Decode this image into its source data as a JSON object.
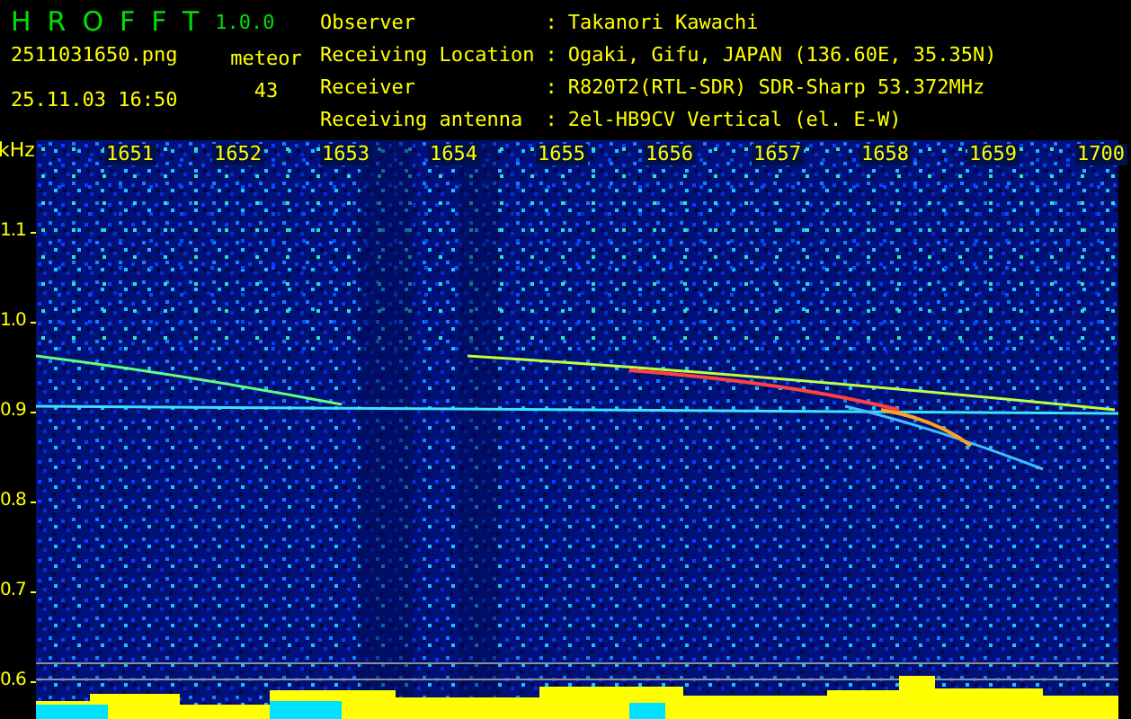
{
  "header": {
    "app_name": "HROFFT",
    "version": "1.0.0",
    "filename": "2511031650.png",
    "datetime": "25.11.03 16:50",
    "meteor_label": "meteor",
    "meteor_count": "43"
  },
  "station_info": [
    {
      "label": "Observer",
      "separator": ":",
      "value": "Takanori Kawachi"
    },
    {
      "label": "Receiving Location",
      "separator": ":",
      "value": "Ogaki, Gifu, JAPAN (136.60E, 35.35N)"
    },
    {
      "label": "Receiver",
      "separator": ":",
      "value": "R820T2(RTL-SDR) SDR-Sharp 53.372MHz"
    },
    {
      "label": "Receiving antenna",
      "separator": ":",
      "value": "2el-HB9CV Vertical (el. E-W)"
    }
  ],
  "spectrogram": {
    "unit": "kHz",
    "frequency_labels": [
      "1.1",
      "1.0",
      "0.9",
      "0.8",
      "0.7",
      "0.6"
    ],
    "time_labels": [
      "1651",
      "1652",
      "1653",
      "1654",
      "1655",
      "1656",
      "1657",
      "1658",
      "1659",
      "1700"
    ]
  }
}
